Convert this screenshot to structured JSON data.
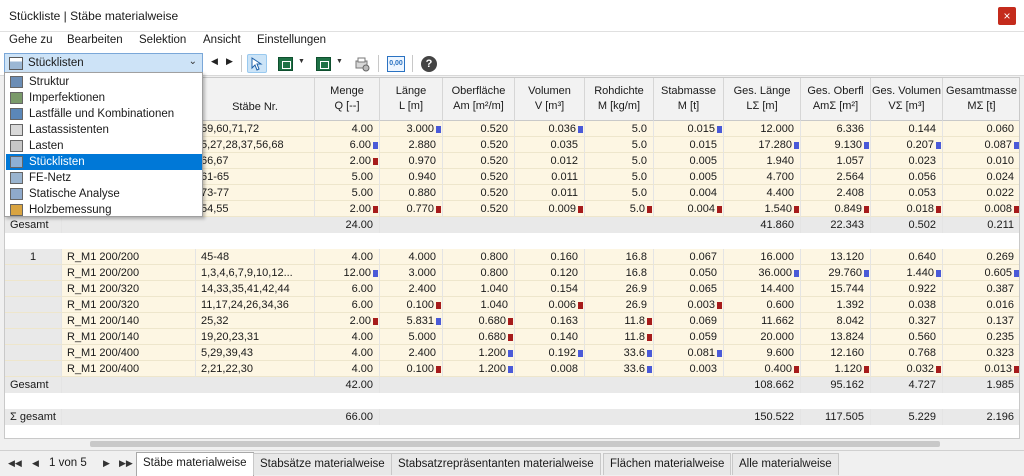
{
  "window": {
    "title": "Stückliste | Stäbe materialweise",
    "close": "×"
  },
  "menu": [
    "Gehe zu",
    "Bearbeiten",
    "Selektion",
    "Ansicht",
    "Einstellungen"
  ],
  "toolbar": {
    "combo_value": "Stücklisten",
    "decimals_icon_text": "0,00",
    "help_text": "?"
  },
  "dropdown": [
    {
      "label": "Struktur",
      "icon": "structure-icon",
      "color": "#6b8db5",
      "selected": false
    },
    {
      "label": "Imperfektionen",
      "icon": "imperfection-icon",
      "color": "#7a9a6a",
      "selected": false
    },
    {
      "label": "Lastfälle und Kombinationen",
      "icon": "loadcase-icon",
      "color": "#5b87b8",
      "selected": false
    },
    {
      "label": "Lastassistenten",
      "icon": "load-wizard-icon",
      "color": "#d8d8d8",
      "selected": false
    },
    {
      "label": "Lasten",
      "icon": "loads-icon",
      "color": "#c7c7c7",
      "selected": false
    },
    {
      "label": "Stücklisten",
      "icon": "partslist-icon",
      "color": "#8fb0d4",
      "selected": true
    },
    {
      "label": "FE-Netz",
      "icon": "fe-mesh-icon",
      "color": "#9ab4cf",
      "selected": false
    },
    {
      "label": "Statische Analyse",
      "icon": "analysis-icon",
      "color": "#8faacc",
      "selected": false
    },
    {
      "label": "Holzbemessung",
      "icon": "timber-design-icon",
      "color": "#d9a441",
      "selected": false
    }
  ],
  "columns": [
    {
      "line1": "",
      "line2": ""
    },
    {
      "line1": "",
      "line2": ""
    },
    {
      "line1": "Stäbe Nr.",
      "line2": ""
    },
    {
      "line1": "Menge",
      "line2": "Q [--]"
    },
    {
      "line1": "Länge",
      "line2": "L [m]"
    },
    {
      "line1": "Oberfläche",
      "line2": "Am [m²/m]"
    },
    {
      "line1": "Volumen",
      "line2": "V [m³]"
    },
    {
      "line1": "Rohdichte",
      "line2": "M [kg/m]"
    },
    {
      "line1": "Stabmasse",
      "line2": "M [t]"
    },
    {
      "line1": "Ges. Länge",
      "line2": "LΣ [m]"
    },
    {
      "line1": "Ges. Oberfl",
      "line2": "AmΣ [m²]"
    },
    {
      "line1": "Ges. Volumen",
      "line2": "VΣ [m³]"
    },
    {
      "line1": "Gesamtmasse",
      "line2": "MΣ [t]"
    }
  ],
  "group1": {
    "rows": [
      {
        "grp": "",
        "section": "",
        "members": "59,60,71,72",
        "q": "4.00",
        "l": "3.000",
        "am": "0.520",
        "v": "0.036",
        "rho": "5.0",
        "m": "0.015",
        "lsum": "12.000",
        "asum": "6.336",
        "vsum": "0.144",
        "msum": "0.060",
        "marks": {
          "l": "blue",
          "v": "blue",
          "m": "blue"
        }
      },
      {
        "grp": "",
        "section": "",
        "members": "5,27,28,37,56,68",
        "q": "6.00",
        "l": "2.880",
        "am": "0.520",
        "v": "0.035",
        "rho": "5.0",
        "m": "0.015",
        "lsum": "17.280",
        "asum": "9.130",
        "vsum": "0.207",
        "msum": "0.087",
        "marks": {
          "q": "blue",
          "lsum": "blue",
          "asum": "blue",
          "vsum": "blue",
          "msum": "blue"
        }
      },
      {
        "grp": "",
        "section": "",
        "members": "66,67",
        "q": "2.00",
        "l": "0.970",
        "am": "0.520",
        "v": "0.012",
        "rho": "5.0",
        "m": "0.005",
        "lsum": "1.940",
        "asum": "1.057",
        "vsum": "0.023",
        "msum": "0.010",
        "marks": {
          "q": "red"
        }
      },
      {
        "grp": "",
        "section": "",
        "members": "61-65",
        "q": "5.00",
        "l": "0.940",
        "am": "0.520",
        "v": "0.011",
        "rho": "5.0",
        "m": "0.005",
        "lsum": "4.700",
        "asum": "2.564",
        "vsum": "0.056",
        "msum": "0.024",
        "marks": {}
      },
      {
        "grp": "",
        "section": "",
        "members": "73-77",
        "q": "5.00",
        "l": "0.880",
        "am": "0.520",
        "v": "0.011",
        "rho": "5.0",
        "m": "0.004",
        "lsum": "4.400",
        "asum": "2.408",
        "vsum": "0.053",
        "msum": "0.022",
        "marks": {}
      },
      {
        "grp": "",
        "section": "",
        "members": "54,55",
        "q": "2.00",
        "l": "0.770",
        "am": "0.520",
        "v": "0.009",
        "rho": "5.0",
        "m": "0.004",
        "lsum": "1.540",
        "asum": "0.849",
        "vsum": "0.018",
        "msum": "0.008",
        "marks": {
          "q": "red",
          "l": "red",
          "v": "red",
          "rho": "red",
          "m": "red",
          "lsum": "red",
          "asum": "red",
          "vsum": "red",
          "msum": "red"
        }
      }
    ],
    "total": {
      "label": "Gesamt",
      "q": "24.00",
      "lsum": "41.860",
      "asum": "22.343",
      "vsum": "0.502",
      "msum": "0.211"
    }
  },
  "group2": {
    "number": "1",
    "rows": [
      {
        "section": "R_M1 200/200",
        "members": "45-48",
        "q": "4.00",
        "l": "4.000",
        "am": "0.800",
        "v": "0.160",
        "rho": "16.8",
        "m": "0.067",
        "lsum": "16.000",
        "asum": "13.120",
        "vsum": "0.640",
        "msum": "0.269",
        "marks": {}
      },
      {
        "section": "R_M1 200/200",
        "members": "1,3,4,6,7,9,10,12...",
        "q": "12.00",
        "l": "3.000",
        "am": "0.800",
        "v": "0.120",
        "rho": "16.8",
        "m": "0.050",
        "lsum": "36.000",
        "asum": "29.760",
        "vsum": "1.440",
        "msum": "0.605",
        "marks": {
          "q": "blue",
          "lsum": "blue",
          "asum": "blue",
          "vsum": "blue",
          "msum": "blue"
        }
      },
      {
        "section": "R_M1 200/320",
        "members": "14,33,35,41,42,44",
        "q": "6.00",
        "l": "2.400",
        "am": "1.040",
        "v": "0.154",
        "rho": "26.9",
        "m": "0.065",
        "lsum": "14.400",
        "asum": "15.744",
        "vsum": "0.922",
        "msum": "0.387",
        "marks": {}
      },
      {
        "section": "R_M1 200/320",
        "members": "11,17,24,26,34,36",
        "q": "6.00",
        "l": "0.100",
        "am": "1.040",
        "v": "0.006",
        "rho": "26.9",
        "m": "0.003",
        "lsum": "0.600",
        "asum": "1.392",
        "vsum": "0.038",
        "msum": "0.016",
        "marks": {
          "l": "red",
          "v": "red",
          "m": "red"
        }
      },
      {
        "section": "R_M1 200/140",
        "members": "25,32",
        "q": "2.00",
        "l": "5.831",
        "am": "0.680",
        "v": "0.163",
        "rho": "11.8",
        "m": "0.069",
        "lsum": "11.662",
        "asum": "8.042",
        "vsum": "0.327",
        "msum": "0.137",
        "marks": {
          "q": "red",
          "l": "blue",
          "am": "red",
          "rho": "red"
        }
      },
      {
        "section": "R_M1 200/140",
        "members": "19,20,23,31",
        "q": "4.00",
        "l": "5.000",
        "am": "0.680",
        "v": "0.140",
        "rho": "11.8",
        "m": "0.059",
        "lsum": "20.000",
        "asum": "13.824",
        "vsum": "0.560",
        "msum": "0.235",
        "marks": {
          "am": "red",
          "rho": "red"
        }
      },
      {
        "section": "R_M1 200/400",
        "members": "5,29,39,43",
        "q": "4.00",
        "l": "2.400",
        "am": "1.200",
        "v": "0.192",
        "rho": "33.6",
        "m": "0.081",
        "lsum": "9.600",
        "asum": "12.160",
        "vsum": "0.768",
        "msum": "0.323",
        "marks": {
          "am": "blue",
          "v": "blue",
          "rho": "blue",
          "m": "blue"
        }
      },
      {
        "section": "R_M1 200/400",
        "members": "2,21,22,30",
        "q": "4.00",
        "l": "0.100",
        "am": "1.200",
        "v": "0.008",
        "rho": "33.6",
        "m": "0.003",
        "lsum": "0.400",
        "asum": "1.120",
        "vsum": "0.032",
        "msum": "0.013",
        "marks": {
          "l": "red",
          "am": "blue",
          "rho": "blue",
          "lsum": "red",
          "asum": "red",
          "vsum": "red",
          "msum": "red"
        }
      }
    ],
    "total": {
      "label": "Gesamt",
      "q": "42.00",
      "lsum": "108.662",
      "asum": "95.162",
      "vsum": "4.727",
      "msum": "1.985"
    }
  },
  "grand_total": {
    "label": "Σ gesamt",
    "q": "66.00",
    "lsum": "150.522",
    "asum": "117.505",
    "vsum": "5.229",
    "msum": "2.196"
  },
  "pager": {
    "text": "1 von 5"
  },
  "tabs": [
    {
      "label": "Stäbe materialweise",
      "active": true
    },
    {
      "label": "Stabsätze materialweise",
      "active": false
    },
    {
      "label": "Stabsatzrepräsentanten materialweise",
      "active": false
    },
    {
      "label": "Flächen materialweise",
      "active": false
    },
    {
      "label": "Alle materialweise",
      "active": false
    }
  ],
  "colors": {
    "row_bg": "#fdf6e3",
    "total_bg": "#e9e9e9",
    "selection": "#0078d7",
    "mark_blue": "#4a5ad8",
    "mark_red": "#a61b1b"
  }
}
